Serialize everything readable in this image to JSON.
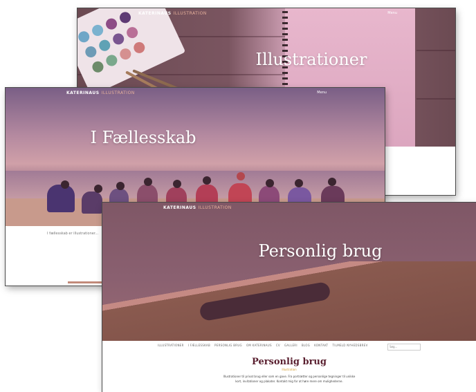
{
  "cards": {
    "illustration": {
      "title": "Illustrationer",
      "brand": "KATERINAUS",
      "brand_accent": "ILLUSTRATION",
      "menu": "Menu"
    },
    "community": {
      "title": "I Fællesskab",
      "brand": "KATERINAUS",
      "brand_accent": "ILLUSTRATION",
      "menu": "Menu",
      "body_snippet": "I fællesskab er illustrationer..."
    },
    "personal": {
      "title": "Personlig brug",
      "brand": "KATERINAUS",
      "brand_accent": "ILLUSTRATION",
      "nav": [
        "ILLUSTRATIONER",
        "I FÆLLESSKAB",
        "PERSONLIG BRUG",
        "OM KATERINAUS",
        "CV",
        "GALLERI",
        "BLOG",
        "KONTAKT",
        "TILMELD NYHEDSBREV"
      ],
      "search_placeholder": "Søg...",
      "section_title": "Personlig brug",
      "section_sub": "Illustration",
      "section_body": "Illustrationer til privat brug eller som en gave. Fra portrætter og personlige tegninger til unikke kort, invitationer og plakater. Kontakt mig for at høre mere om mulighederne."
    }
  },
  "colors": {
    "overlay": "#b5708a",
    "accent_gold": "#d39b2a",
    "title_dark": "#5a2030"
  }
}
